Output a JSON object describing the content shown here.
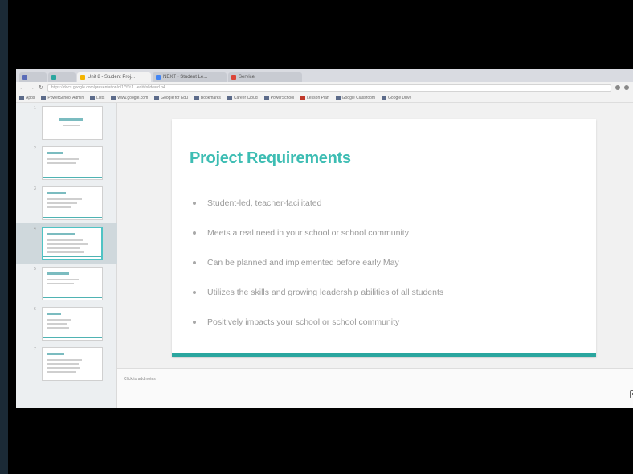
{
  "browser": {
    "tabs": [
      {
        "label": "",
        "color": "#5a6cb8"
      },
      {
        "label": "",
        "color": "#2aa69f"
      },
      {
        "label": "Unit 8 - Student Proj...",
        "color": "#f4b400"
      },
      {
        "label": "NEXT - Student Le...",
        "color": "#4285f4"
      },
      {
        "label": "Service",
        "color": "#db4437"
      }
    ],
    "url": "https://docs.google.com/presentation/d/1Yf3tJ.../edit#slide=id.p4",
    "bookmarks": [
      "Apps",
      "PowerSchool Admin",
      "Lists",
      "www.google.com",
      "Google for Edu",
      "Bookmarks",
      "Career Cloud",
      "PowerSchool",
      "Lesson Plan",
      "Google Classroom",
      "Google Drive"
    ]
  },
  "filmstrip": {
    "slides": [
      {
        "num": "1"
      },
      {
        "num": "2"
      },
      {
        "num": "3"
      },
      {
        "num": "4"
      },
      {
        "num": "5"
      },
      {
        "num": "6"
      },
      {
        "num": "7"
      }
    ]
  },
  "slide": {
    "title": "Project Requirements",
    "bullets": [
      "Student-led, teacher-facilitated",
      "Meets a real need in your school or school community",
      "Can be planned and implemented before early May",
      "Utilizes the skills and growing leadership abilities of all students",
      "Positively impacts your school or school community"
    ],
    "accent_color": "#3dbdb3"
  },
  "notes": {
    "placeholder": "Click to add notes"
  }
}
